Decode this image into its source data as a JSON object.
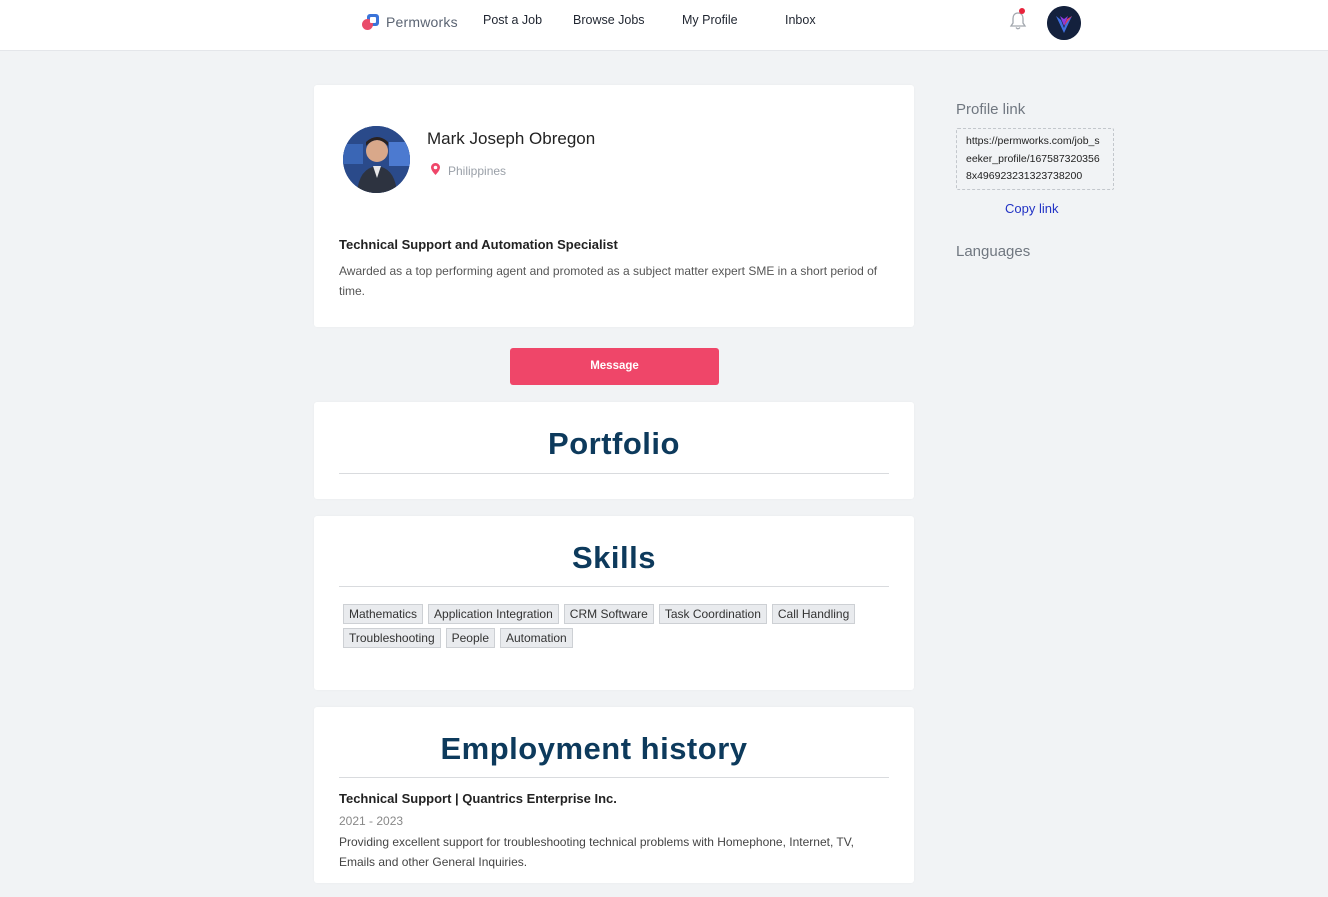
{
  "nav": {
    "brand": "Permworks",
    "links": [
      "Post a Job",
      "Browse Jobs",
      "My Profile",
      "Inbox"
    ]
  },
  "profile": {
    "name": "Mark Joseph Obregon",
    "location": "Philippines",
    "headline": "Technical Support and Automation Specialist",
    "summary": "Awarded as a top performing agent and promoted as a subject matter expert SME in a short period of time."
  },
  "actions": {
    "message_label": "Message"
  },
  "portfolio": {
    "title": "Portfolio"
  },
  "skills": {
    "title": "Skills",
    "items": [
      "Mathematics",
      "Application Integration",
      "CRM Software",
      "Task Coordination",
      "Call Handling",
      "Troubleshooting",
      "People",
      "Automation"
    ]
  },
  "employment": {
    "title": "Employment history",
    "jobs": [
      {
        "title": "Technical Support | Quantrics Enterprise Inc.",
        "dates": "2021 - 2023",
        "description": "Providing excellent support for troubleshooting technical problems with Homephone, Internet, TV, Emails and other General Inquiries."
      }
    ]
  },
  "sidebar": {
    "profile_link_label": "Profile link",
    "profile_link_url": "https://permworks.com/job_seeker_profile/1675873203568x496923231323738200",
    "copy_link_label": "Copy link",
    "languages_label": "Languages"
  },
  "colors": {
    "accent": "#ef4669",
    "heading": "#0d3a5c",
    "link": "#2233c5",
    "notification_dot": "#e8233b"
  },
  "icons": [
    "permworks-logo",
    "bell-icon",
    "user-avatar",
    "location-pin-icon"
  ]
}
